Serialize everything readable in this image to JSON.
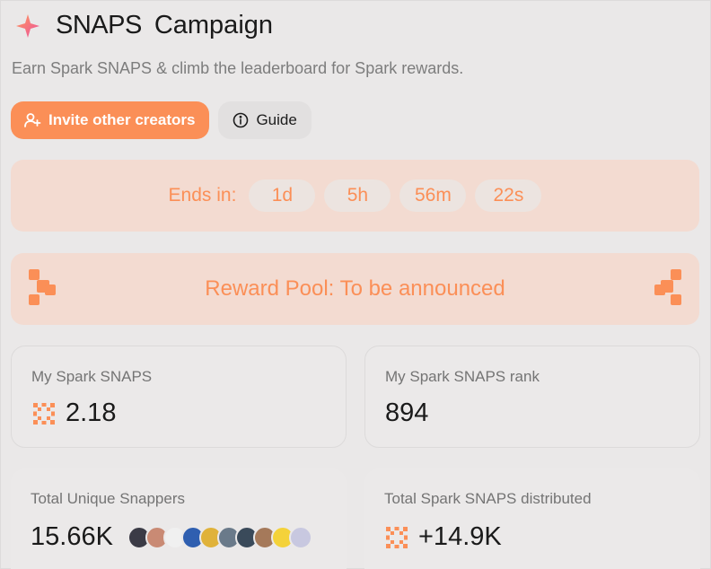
{
  "header": {
    "title_part1": "SNAPS",
    "title_part2": "Campaign",
    "subtitle": "Earn Spark SNAPS & climb the leaderboard for Spark rewards.",
    "logo_icon": "sparkle-icon"
  },
  "buttons": {
    "invite_label": "Invite other creators",
    "invite_icon": "add-user-icon",
    "guide_label": "Guide",
    "guide_icon": "info-icon"
  },
  "timer": {
    "label": "Ends in:",
    "days": "1d",
    "hours": "5h",
    "minutes": "56m",
    "seconds": "22s"
  },
  "reward": {
    "text": "Reward Pool: To be announced"
  },
  "stats": {
    "my_snaps_label": "My Spark SNAPS",
    "my_snaps_value": "2.18",
    "rank_label": "My Spark SNAPS rank",
    "rank_value": "894",
    "snappers_label": "Total Unique Snappers",
    "snappers_value": "15.66K",
    "distributed_label": "Total Spark SNAPS distributed",
    "distributed_value": "+14.9K"
  },
  "colors": {
    "accent": "#fb8f57",
    "accent_bg": "#f3dbd1",
    "background": "#eae8e8"
  }
}
